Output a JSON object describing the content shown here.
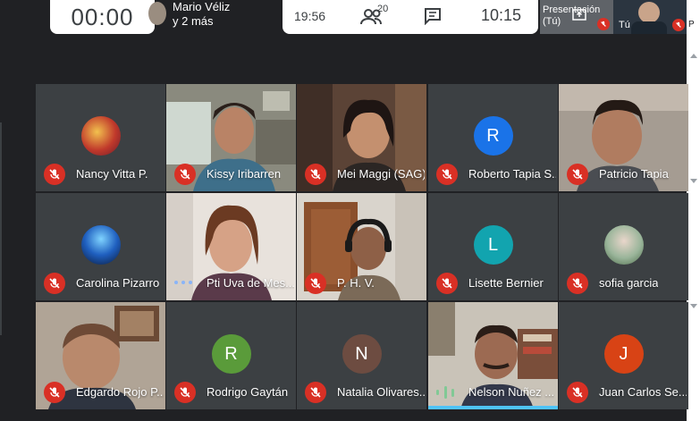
{
  "header": {
    "timer": "00:00",
    "presenter_line1": "Mario Véliz",
    "presenter_line2": "y 2 más",
    "time_a": "19:56",
    "participant_count": "20",
    "time_b": "10:15",
    "presentation_label_1": "Presentación",
    "presentation_label_2": "(Tú)",
    "self_label": "Tú",
    "edge_label": "P"
  },
  "tiles": [
    {
      "name": "Nancy Vitta P.",
      "kind": "photo-avatar",
      "mic": "muted"
    },
    {
      "name": "Kissy Iribarren",
      "kind": "video",
      "mic": "muted"
    },
    {
      "name": "Mei Maggi (SAG)",
      "kind": "video",
      "mic": "muted"
    },
    {
      "name": "Roberto Tapia S...",
      "kind": "letter",
      "letter": "R",
      "color": "#1a73e8",
      "mic": "muted"
    },
    {
      "name": "Patricio Tapia",
      "kind": "video",
      "mic": "muted"
    },
    {
      "name": "Carolina Pizarro",
      "kind": "photo-avatar",
      "mic": "muted"
    },
    {
      "name": "Pti Uva de Mes...",
      "kind": "video",
      "mic": "speaking"
    },
    {
      "name": "P. H. V.",
      "kind": "video",
      "mic": "muted"
    },
    {
      "name": "Lisette Bernier",
      "kind": "letter",
      "letter": "L",
      "color": "#12a4af",
      "mic": "muted"
    },
    {
      "name": "sofia garcia",
      "kind": "photo-avatar",
      "mic": "muted"
    },
    {
      "name": "Edgardo Rojo P...",
      "kind": "video",
      "mic": "muted"
    },
    {
      "name": "Rodrigo Gaytán",
      "kind": "letter",
      "letter": "R",
      "color": "#5a9b3a",
      "mic": "muted"
    },
    {
      "name": "Natalia Olivares...",
      "kind": "letter",
      "letter": "N",
      "color": "#6d4c41",
      "mic": "muted"
    },
    {
      "name": "Nelson Nuñez ...",
      "kind": "video",
      "mic": "active"
    },
    {
      "name": "Juan Carlos Se...",
      "kind": "letter",
      "letter": "J",
      "color": "#d84315",
      "mic": "muted"
    }
  ],
  "colors": {
    "background": "#202124",
    "tile": "#3c4043",
    "mic_muted": "#d93025",
    "active_speaker": "#4fc3f7"
  },
  "icons": [
    "participants-icon",
    "chat-icon",
    "mic-off-icon",
    "present-icon",
    "audio-wave-icon",
    "speaking-dots-icon"
  ]
}
